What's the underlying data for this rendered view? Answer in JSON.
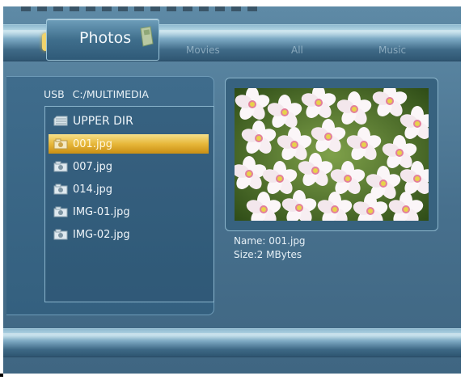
{
  "tabs": {
    "active": "Photos",
    "others": [
      "Movies",
      "All",
      "Music"
    ]
  },
  "browser": {
    "device": "USB",
    "path": "C:/MULTIMEDIA",
    "updir_label": "UPPER DIR",
    "files": [
      "001.jpg",
      "007.jpg",
      "014.jpg",
      "IMG-01.jpg",
      "IMG-02.jpg"
    ],
    "selected_index": 0
  },
  "preview": {
    "name_line": "Name: 001.jpg",
    "size_line": "Size:2 MBytes"
  },
  "colors": {
    "accent": "#e7b73a",
    "panel": "#3f6c8c",
    "background": "#47708d"
  }
}
